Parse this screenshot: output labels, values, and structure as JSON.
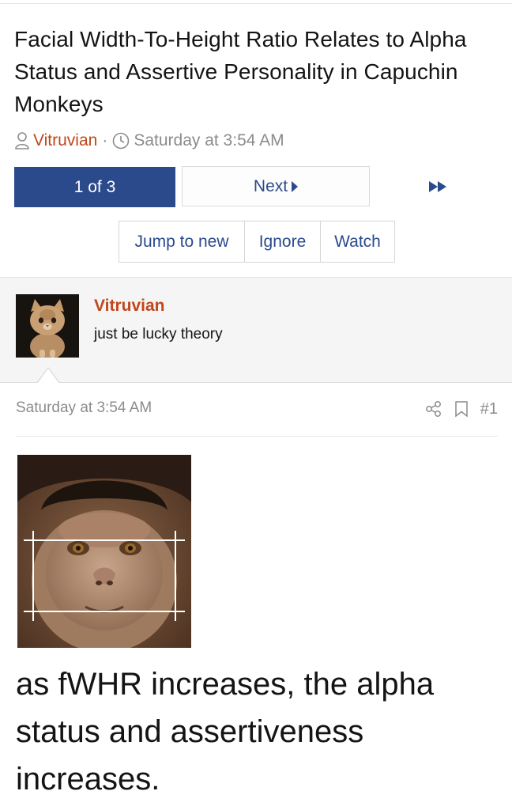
{
  "thread": {
    "title": "Facial Width-To-Height Ratio Relates to Alpha Status and Assertive Personality in Capuchin Monkeys",
    "author": "Vitruvian",
    "separator": "·",
    "date": "Saturday at 3:54 AM"
  },
  "pagination": {
    "current_label": "1 of 3",
    "next_label": "Next",
    "last_icon": "fast-forward-icon"
  },
  "actions": {
    "jump_label": "Jump to new",
    "ignore_label": "Ignore",
    "watch_label": "Watch"
  },
  "poster": {
    "name": "Vitruvian",
    "user_title": "just be lucky theory",
    "avatar_icon": "kitten-avatar"
  },
  "post": {
    "date": "Saturday at 3:54 AM",
    "share_icon": "share-icon",
    "bookmark_icon": "bookmark-icon",
    "number": "#1",
    "image": "capuchin-face-measurement-photo",
    "body": "as fWHR increases, the alpha status and assertiveness increases."
  },
  "colors": {
    "accent_blue": "#2b4a8c",
    "author_orange": "#c0461b",
    "muted_gray": "#8c8c8c"
  }
}
